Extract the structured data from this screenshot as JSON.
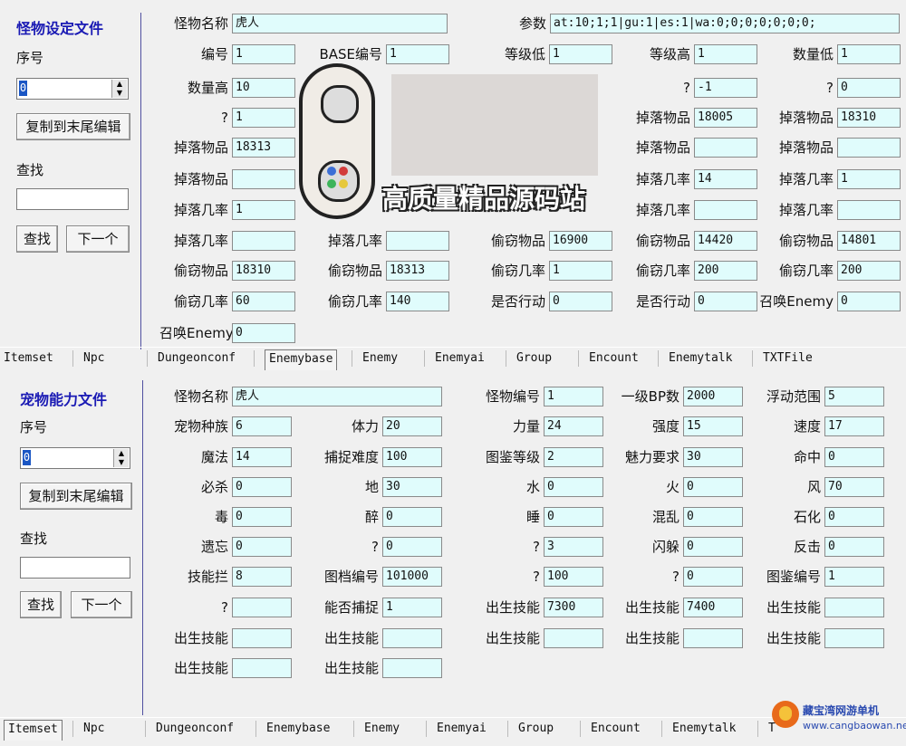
{
  "top": {
    "panel_title": "怪物设定文件",
    "seq_label": "序号",
    "seq_value": "0",
    "copy_button": "复制到末尾编辑",
    "search_label": "查找",
    "search_value": "",
    "search_button": "查找",
    "next_button": "下一个",
    "fields": [
      {
        "label": "怪物名称",
        "value": "虎人"
      },
      {
        "label": "参数",
        "value": "at:10;1;1|gu:1|es:1|wa:0;0;0;0;0;0;0;"
      },
      {
        "label": "编号",
        "value": "1"
      },
      {
        "label": "BASE编号",
        "value": "1"
      },
      {
        "label": "等级低",
        "value": "1"
      },
      {
        "label": "等级高",
        "value": "1"
      },
      {
        "label": "数量低",
        "value": "1"
      },
      {
        "label": "数量高",
        "value": "10"
      },
      {
        "label": "?",
        "value": "-1"
      },
      {
        "label": "?",
        "value": "0"
      },
      {
        "label": "?",
        "value": "1"
      },
      {
        "label": "掉落物品",
        "value": "18005"
      },
      {
        "label": "掉落物品",
        "value": "18310"
      },
      {
        "label": "掉落物品",
        "value": "18313"
      },
      {
        "label": "掉落物品",
        "value": ""
      },
      {
        "label": "掉落物品",
        "value": ""
      },
      {
        "label": "掉落物品",
        "value": ""
      },
      {
        "label": "掉落几率",
        "value": "14"
      },
      {
        "label": "掉落几率",
        "value": "1"
      },
      {
        "label": "掉落几率",
        "value": "1"
      },
      {
        "label": "掉落几率",
        "value": ""
      },
      {
        "label": "掉落几率",
        "value": ""
      },
      {
        "label": "掉落几率",
        "value": ""
      },
      {
        "label": "掉落几率",
        "value": ""
      },
      {
        "label": "偷窃物品",
        "value": "16900"
      },
      {
        "label": "偷窃物品",
        "value": "14420"
      },
      {
        "label": "偷窃物品",
        "value": "14801"
      },
      {
        "label": "偷窃物品",
        "value": "18310"
      },
      {
        "label": "偷窃物品",
        "value": "18313"
      },
      {
        "label": "偷窃几率",
        "value": "1"
      },
      {
        "label": "偷窃几率",
        "value": "200"
      },
      {
        "label": "偷窃几率",
        "value": "200"
      },
      {
        "label": "偷窃几率",
        "value": "60"
      },
      {
        "label": "偷窃几率",
        "value": "140"
      },
      {
        "label": "是否行动",
        "value": "0"
      },
      {
        "label": "是否行动",
        "value": "0"
      },
      {
        "label": "召唤Enemy",
        "value": "0"
      },
      {
        "label": "召唤Enemy",
        "value": "0"
      },
      {
        "label": "Talk编号",
        "value": "0"
      }
    ]
  },
  "watermark": {
    "text": "高质量精品源码站"
  },
  "tabs_top": [
    "Itemset",
    "Npc",
    "Dungeonconf",
    "Enemybase",
    "Enemy",
    "Enemyai",
    "Group",
    "Encount",
    "Enemytalk",
    "TXTFile"
  ],
  "bottom": {
    "panel_title": "宠物能力文件",
    "seq_label": "序号",
    "seq_value": "0",
    "copy_button": "复制到末尾编辑",
    "search_label": "查找",
    "search_value": "",
    "search_button": "查找",
    "next_button": "下一个",
    "fields": [
      {
        "label": "怪物名称",
        "value": "虎人"
      },
      {
        "label": "怪物编号",
        "value": "1"
      },
      {
        "label": "一级BP数",
        "value": "2000"
      },
      {
        "label": "浮动范围",
        "value": "5"
      },
      {
        "label": "宠物种族",
        "value": "6"
      },
      {
        "label": "体力",
        "value": "20"
      },
      {
        "label": "力量",
        "value": "24"
      },
      {
        "label": "强度",
        "value": "15"
      },
      {
        "label": "速度",
        "value": "17"
      },
      {
        "label": "魔法",
        "value": "14"
      },
      {
        "label": "捕捉难度",
        "value": "100"
      },
      {
        "label": "图鉴等级",
        "value": "2"
      },
      {
        "label": "魅力要求",
        "value": "30"
      },
      {
        "label": "命中",
        "value": "0"
      },
      {
        "label": "必杀",
        "value": "0"
      },
      {
        "label": "地",
        "value": "30"
      },
      {
        "label": "水",
        "value": "0"
      },
      {
        "label": "火",
        "value": "0"
      },
      {
        "label": "风",
        "value": "70"
      },
      {
        "label": "毒",
        "value": "0"
      },
      {
        "label": "醉",
        "value": "0"
      },
      {
        "label": "睡",
        "value": "0"
      },
      {
        "label": "混乱",
        "value": "0"
      },
      {
        "label": "石化",
        "value": "0"
      },
      {
        "label": "遗忘",
        "value": "0"
      },
      {
        "label": "?",
        "value": "0"
      },
      {
        "label": "?",
        "value": "3"
      },
      {
        "label": "闪躲",
        "value": "0"
      },
      {
        "label": "反击",
        "value": "0"
      },
      {
        "label": "技能拦",
        "value": "8"
      },
      {
        "label": "图档编号",
        "value": "101000"
      },
      {
        "label": "?",
        "value": "100"
      },
      {
        "label": "?",
        "value": "0"
      },
      {
        "label": "图鉴编号",
        "value": "1"
      },
      {
        "label": "?",
        "value": ""
      },
      {
        "label": "能否捕捉",
        "value": "1"
      },
      {
        "label": "出生技能",
        "value": "7300"
      },
      {
        "label": "出生技能",
        "value": "7400"
      },
      {
        "label": "出生技能",
        "value": ""
      },
      {
        "label": "出生技能",
        "value": ""
      },
      {
        "label": "出生技能",
        "value": ""
      },
      {
        "label": "出生技能",
        "value": ""
      },
      {
        "label": "出生技能",
        "value": ""
      },
      {
        "label": "出生技能",
        "value": ""
      },
      {
        "label": "出生技能",
        "value": ""
      },
      {
        "label": "出生技能",
        "value": ""
      }
    ]
  },
  "tabs_bottom": [
    "Itemset",
    "Npc",
    "Dungeonconf",
    "Enemybase",
    "Enemy",
    "Enemyai",
    "Group",
    "Encount",
    "Enemytalk",
    "T"
  ],
  "logo": {
    "name": "藏宝湾网游单机",
    "url": "www.cangbaowan.net"
  }
}
